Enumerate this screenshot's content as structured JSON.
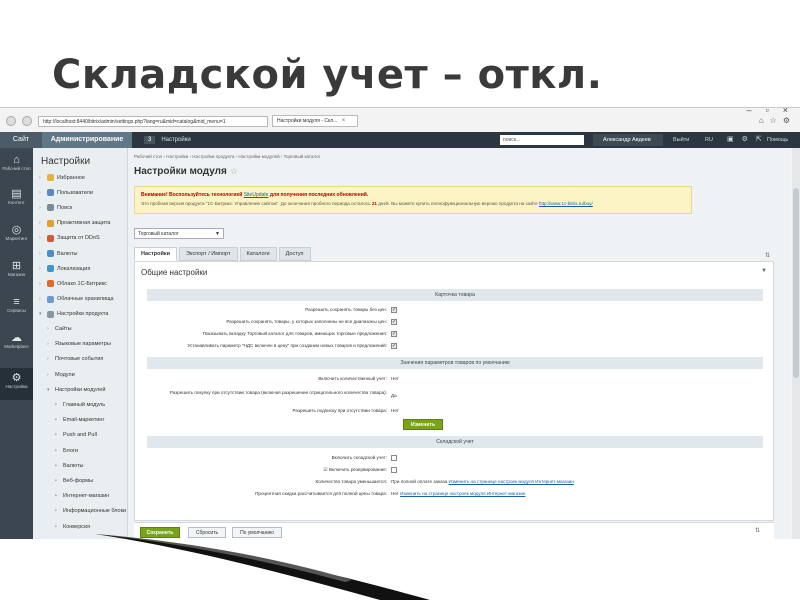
{
  "slide": {
    "title": "Складской учет – откл."
  },
  "browser": {
    "address": "http://localhost:8440/bitrix/admin/settings.php?lang=ru&mid=catalog&mid_menu=1",
    "tab_label": "Настройки модуля - Скл...",
    "tab_close": "×",
    "window_controls": [
      "–",
      "▫",
      "×"
    ],
    "icons": [
      "⌂",
      "☆",
      "⚙"
    ]
  },
  "topbar": {
    "site": "Сайт",
    "admin": "Администрирование",
    "count": "3",
    "settings": "Настройки",
    "search_placeholder": "поиск...",
    "user": "Александр Авдеев",
    "logout": "Выйти",
    "lang": "RU",
    "help": "Помощь",
    "icons": [
      "▣",
      "⚙",
      "⇱"
    ]
  },
  "iconcol": {
    "items": [
      {
        "label": "Рабочий стол",
        "glyph": "⌂"
      },
      {
        "label": "Контент",
        "glyph": "▤"
      },
      {
        "label": "Маркетинг",
        "glyph": "◎"
      },
      {
        "label": "Магазин",
        "glyph": "⊞"
      },
      {
        "label": "Сервисы",
        "glyph": "≡"
      },
      {
        "label": "Marketplace",
        "glyph": "☁"
      },
      {
        "label": "Настройки",
        "glyph": "⚙"
      }
    ]
  },
  "menu": {
    "title": "Настройки",
    "items": [
      {
        "label": "Избранное",
        "color": "#e8b23a"
      },
      {
        "label": "Пользователи",
        "color": "#5a8ac6"
      },
      {
        "label": "Поиск",
        "color": "#7a8a99"
      },
      {
        "label": "Проактивная защита",
        "color": "#e0a030"
      },
      {
        "label": "Защита от DDoS",
        "color": "#d05a3a"
      },
      {
        "label": "Валюты",
        "color": "#4c8fc4"
      },
      {
        "label": "Локализация",
        "color": "#3c9ac8"
      },
      {
        "label": "Облако 1С-Битрикс",
        "color": "#e06a2a"
      },
      {
        "label": "Облачные хранилища",
        "color": "#6a9ad0"
      },
      {
        "label": "Настройки продукта",
        "color": "#8a96a0"
      },
      {
        "label": "Сайты",
        "color": ""
      },
      {
        "label": "Языковые параметры",
        "color": ""
      },
      {
        "label": "Почтовые события",
        "color": ""
      },
      {
        "label": "Модули",
        "color": ""
      },
      {
        "label": "Настройки модулей",
        "color": ""
      },
      {
        "label": "Главный модуль",
        "color": ""
      },
      {
        "label": "Email-маркетинг",
        "color": ""
      },
      {
        "label": "Push and Pull",
        "color": ""
      },
      {
        "label": "Блоги",
        "color": ""
      },
      {
        "label": "Валюты",
        "color": ""
      },
      {
        "label": "Веб-формы",
        "color": ""
      },
      {
        "label": "Интернет-магазин",
        "color": ""
      },
      {
        "label": "Информационные блоки",
        "color": ""
      },
      {
        "label": "Конверсия",
        "color": ""
      }
    ]
  },
  "content": {
    "breadcrumb": "Рабочий стол  ›  Настройки  ›  Настройки продукта  ›  Настройки модулей  ›  Торговый каталог",
    "page_title": "Настройки модуля",
    "star": "☆",
    "notice": {
      "line1_prefix": "Внимание! Воспользуйтесь технологией",
      "line1_link": "SiteUpdate",
      "line1_suffix": "для получения последних обновлений.",
      "line2_prefix": "Это пробная версия продукта \"1С-Битрикс: Управление сайтом\". До окончания пробного периода осталось",
      "line2_days": "21",
      "line2_middle": "дней. Вы можете купить полнофункциональную версию продукта на сайте",
      "line2_link": "http://www.1c-bitrix.ru/buy/"
    },
    "module_select": "Торговый каталог",
    "tabs": [
      "Настройки",
      "Экспорт / Импорт",
      "Каталоги",
      "Доступ"
    ],
    "tabs_collapse": "⇅",
    "panel_title": "Общие настройки",
    "panel_toggle": "▼",
    "sections": {
      "product_card": "Карточка товара",
      "defaults": "Значения параметров товаров по умолчанию",
      "warehouse": "Складской учет"
    },
    "card_rows": [
      "Разрешить сохранять товары без цен:",
      "Разрешить сохранять товары, у которых заполнены не все диапазоны цен:",
      "Показывать вкладку Торговый каталог для товаров, имеющих торговые предложения:",
      "Устанавливать параметр \"НДС включен в цену\" при создании новых товаров и предложений:"
    ],
    "default_rows": [
      {
        "label": "Включить количественный учет:",
        "value": "Нет"
      },
      {
        "label": "Разрешить покупку при отсутствии товара (включая разрешение отрицательного количества товара):",
        "value": "Да"
      },
      {
        "label": "Разрешить подписку при отсутствии товара:",
        "value": "Нет"
      }
    ],
    "change_button": "Изменить",
    "warehouse_rows": {
      "enable_warehouse": "Включить складской учет:",
      "enable_reserve": "Включить резервирование:",
      "reserve_prefix": "☑",
      "qty_label": "Количество товара уменьшается:",
      "qty_value": "При полной оплате заказа",
      "qty_link": "Изменить на странице настроек модуля Интернет-магазин",
      "discount_label": "Процентная скидка рассчитывается для полной цены товара:",
      "discount_value": "Нет",
      "discount_link": "Изменить на странице настроек модуля Интернет-магазин"
    },
    "footer": {
      "save": "Сохранить",
      "reset": "Сбросить",
      "default": "По умолчанию",
      "collapse": "⇅"
    }
  }
}
